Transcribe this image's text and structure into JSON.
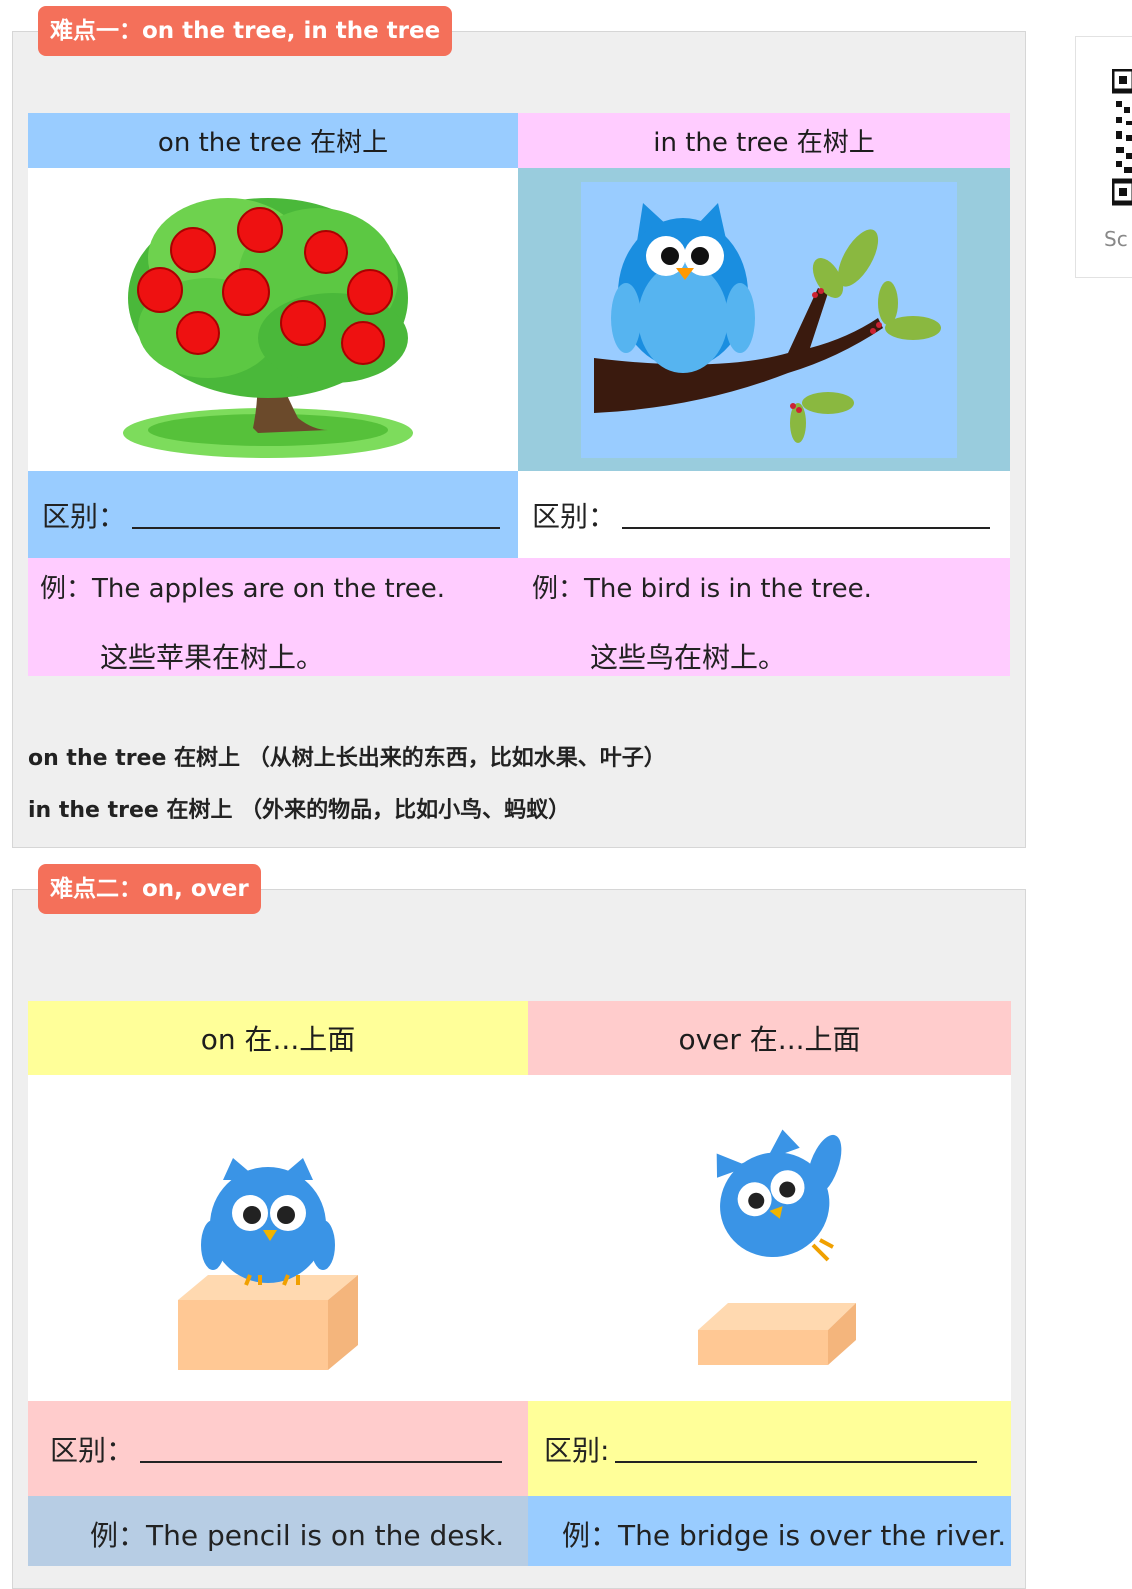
{
  "section1": {
    "tag": "难点一：on the tree, in the tree",
    "left_header": "on the tree  在树上",
    "right_header": "in the tree  在树上",
    "left_diff_label": "区别：",
    "right_diff_label": "区别：",
    "left_example_en": "例：The apples are on the tree.",
    "left_example_cn": "这些苹果在树上。",
    "right_example_en": "例：The bird is in the tree.",
    "right_example_cn": "这些鸟在树上。",
    "note1": "on the tree  在树上 （从树上长出来的东西，比如水果、叶子）",
    "note2": "in the tree 在树上 （外来的物品，比如小鸟、蚂蚁）"
  },
  "section2": {
    "tag": "难点二：on, over",
    "left_header": "on  在...上面",
    "right_header": "over  在...上面",
    "left_diff_label": "区别：",
    "right_diff_label": "区别:",
    "left_example": "例：The pencil is on the desk.",
    "right_example": "例：The bridge is over the river."
  },
  "qr": {
    "caption": "Sc"
  },
  "colors": {
    "tag": "#f4705a",
    "blue": "#99ccff",
    "pink": "#ffccff",
    "yellow": "#ffff99",
    "rose": "#ffcccc",
    "steel": "#b7cde4",
    "teal": "#99ccdd"
  },
  "icons": [
    "apple-tree-illustration",
    "owl-on-branch-illustration",
    "owl-on-box-illustration",
    "owl-over-box-illustration",
    "qr-code-icon"
  ]
}
